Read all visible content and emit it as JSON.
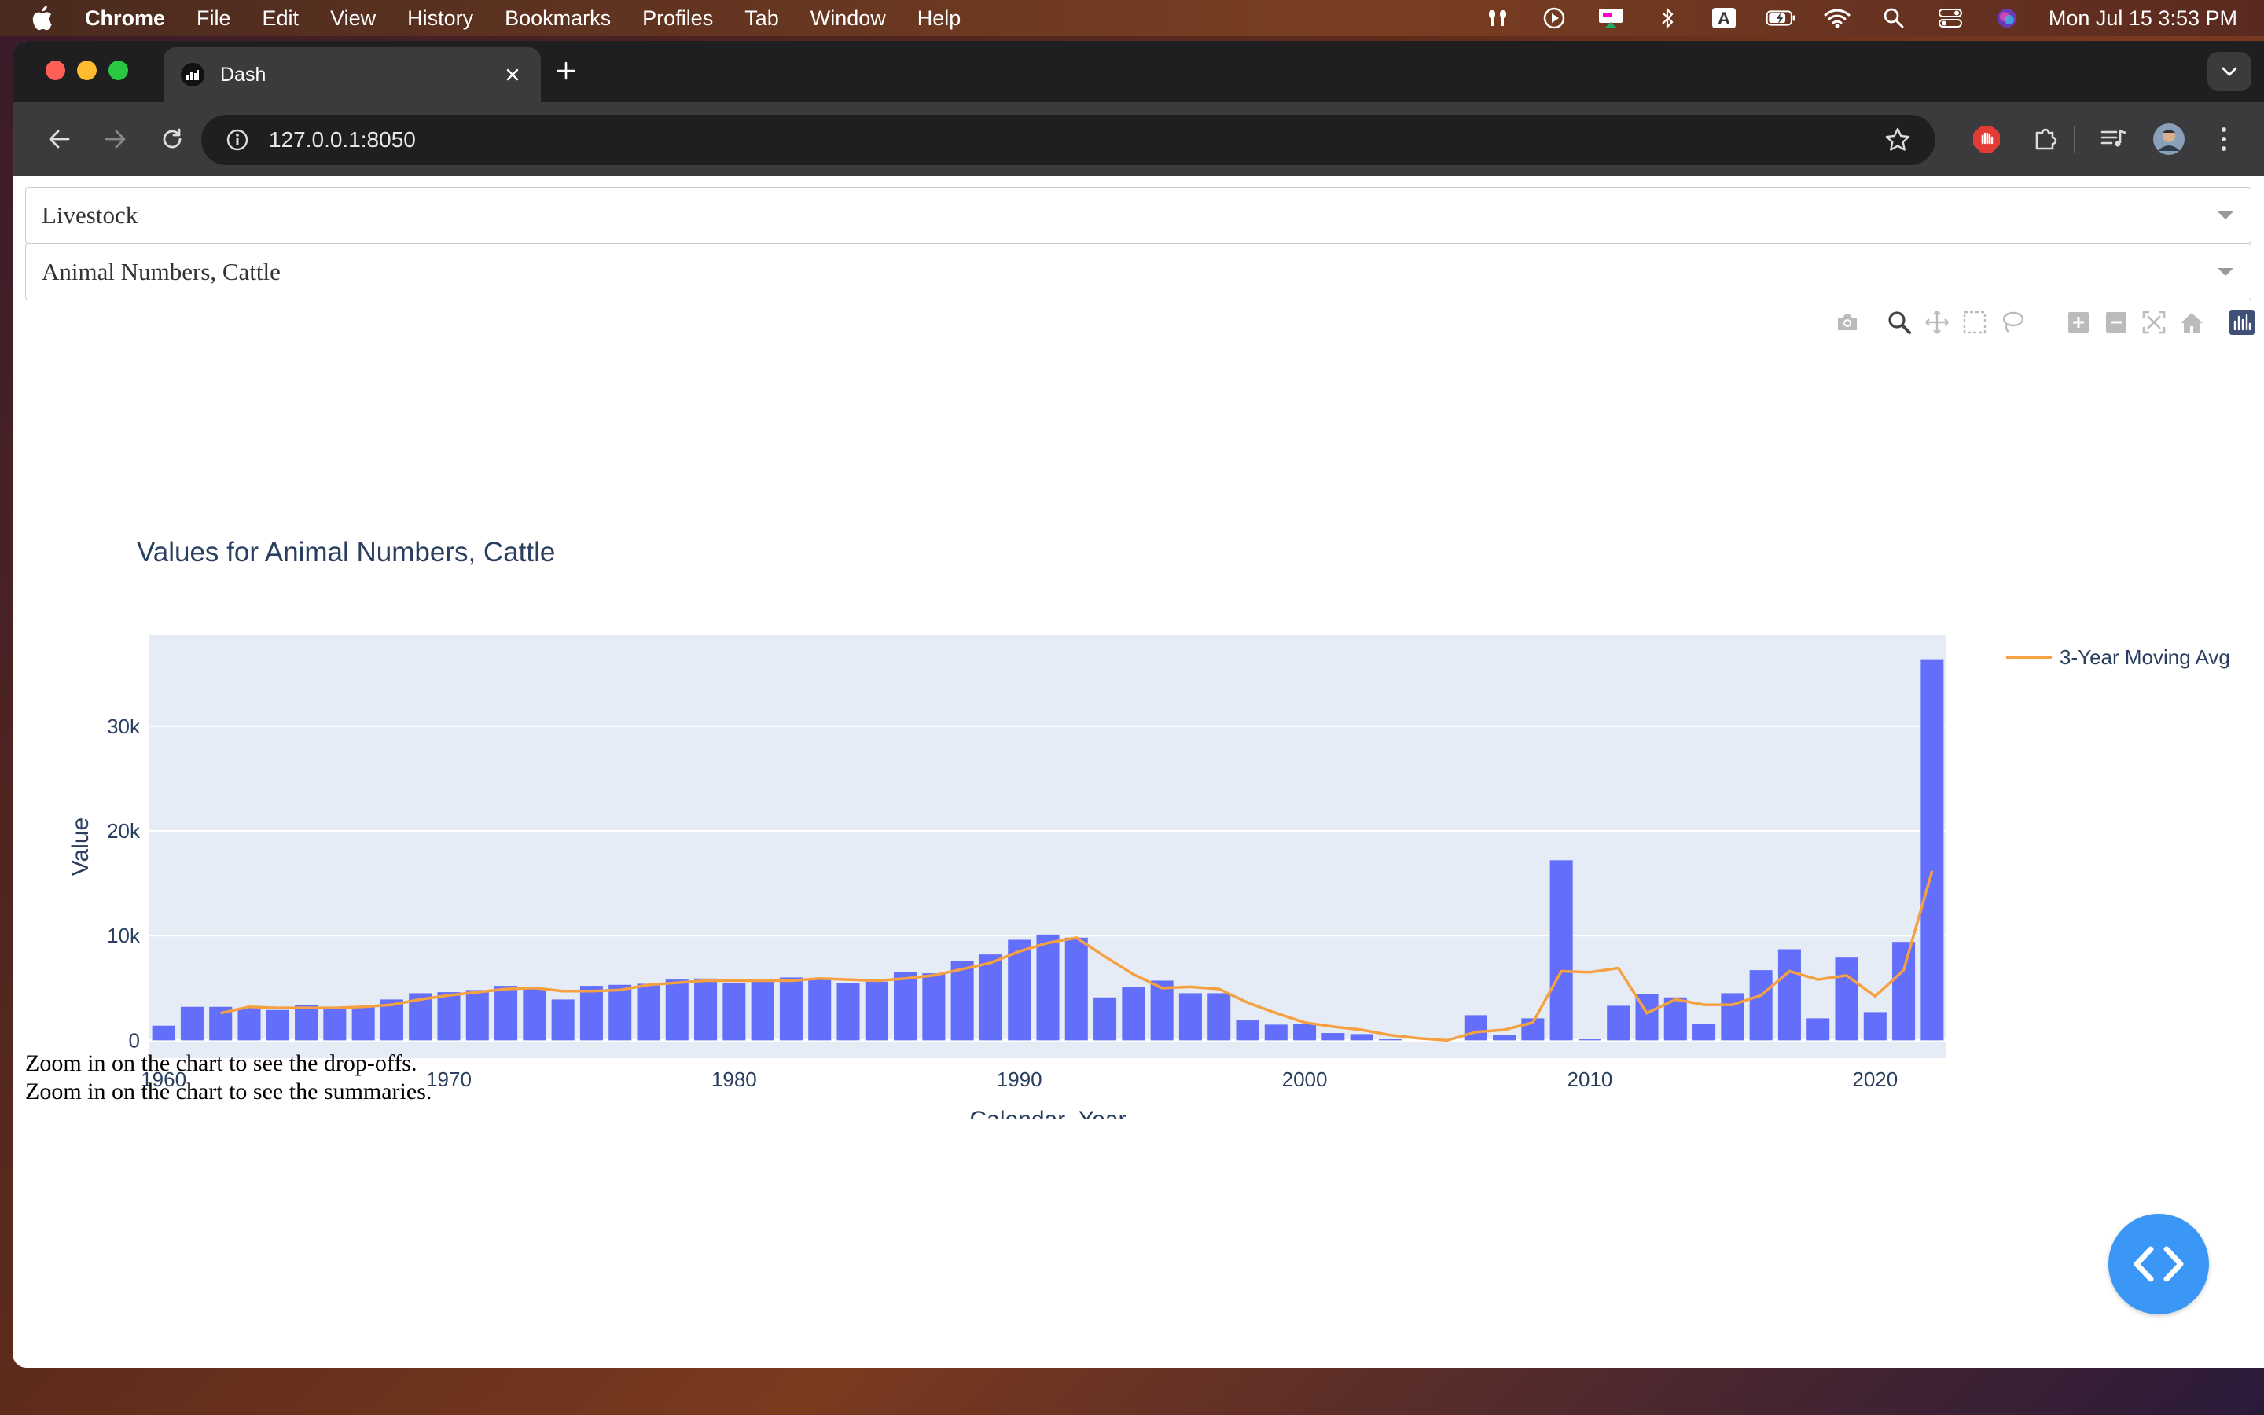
{
  "menubar": {
    "app": "Chrome",
    "items": [
      "File",
      "Edit",
      "View",
      "History",
      "Bookmarks",
      "Profiles",
      "Tab",
      "Window",
      "Help"
    ],
    "clock": "Mon Jul 15  3:53 PM"
  },
  "browser": {
    "tab_title": "Dash",
    "url": "127.0.0.1:8050"
  },
  "dropdowns": {
    "category": "Livestock",
    "item": "Animal Numbers, Cattle"
  },
  "summaries": {
    "dropoffs": "Zoom in on the chart to see the drop-offs.",
    "summaries": "Zoom in on the chart to see the summaries."
  },
  "chart_data": {
    "type": "bar",
    "title": "Values for Animal Numbers, Cattle",
    "xlabel": "Calendar_Year",
    "ylabel": "Value",
    "x": [
      1960,
      1961,
      1962,
      1963,
      1964,
      1965,
      1966,
      1967,
      1968,
      1969,
      1970,
      1971,
      1972,
      1973,
      1974,
      1975,
      1976,
      1977,
      1978,
      1979,
      1980,
      1981,
      1982,
      1983,
      1984,
      1985,
      1986,
      1987,
      1988,
      1989,
      1990,
      1991,
      1992,
      1993,
      1994,
      1995,
      1996,
      1997,
      1998,
      1999,
      2000,
      2001,
      2002,
      2003,
      2004,
      2005,
      2006,
      2007,
      2008,
      2009,
      2010,
      2011,
      2012,
      2013,
      2014,
      2015,
      2016,
      2017,
      2018,
      2019,
      2020,
      2021,
      2022
    ],
    "values": [
      1400,
      3200,
      3200,
      3100,
      2900,
      3400,
      3000,
      3200,
      3900,
      4500,
      4600,
      4800,
      5200,
      4900,
      3900,
      5200,
      5300,
      5400,
      5800,
      5900,
      5500,
      5700,
      6000,
      5900,
      5500,
      5600,
      6500,
      6400,
      7600,
      8200,
      9600,
      10100,
      9800,
      4100,
      5100,
      5700,
      4500,
      4500,
      1900,
      1500,
      1600,
      700,
      600,
      100,
      0,
      0,
      2400,
      500,
      2100,
      17200,
      100,
      3300,
      4400,
      4100,
      1600,
      4500,
      6700,
      8700,
      2100,
      7900,
      2700,
      9400,
      36400
    ],
    "series": [
      {
        "name": "3-Year Moving Avg",
        "type": "line",
        "color": "#f5a142",
        "x": [
          1962,
          1963,
          1964,
          1965,
          1966,
          1967,
          1968,
          1969,
          1970,
          1971,
          1972,
          1973,
          1974,
          1975,
          1976,
          1977,
          1978,
          1979,
          1980,
          1981,
          1982,
          1983,
          1984,
          1985,
          1986,
          1987,
          1988,
          1989,
          1990,
          1991,
          1992,
          1993,
          1994,
          1995,
          1996,
          1997,
          1998,
          1999,
          2000,
          2001,
          2002,
          2003,
          2004,
          2005,
          2006,
          2007,
          2008,
          2009,
          2010,
          2011,
          2012,
          2013,
          2014,
          2015,
          2016,
          2017,
          2018,
          2019,
          2020,
          2021,
          2022
        ],
        "values": [
          2600,
          3200,
          3100,
          3100,
          3100,
          3200,
          3400,
          3900,
          4300,
          4600,
          4900,
          5000,
          4700,
          4700,
          4800,
          5300,
          5500,
          5700,
          5700,
          5700,
          5700,
          5900,
          5800,
          5700,
          5900,
          6200,
          6800,
          7400,
          8500,
          9300,
          9800,
          8000,
          6300,
          5000,
          5100,
          4900,
          3600,
          2600,
          1700,
          1300,
          1000,
          500,
          200,
          0,
          800,
          1000,
          1700,
          6600,
          6500,
          6900,
          2600,
          3900,
          3400,
          3400,
          4300,
          6600,
          5800,
          6200,
          4200,
          6700,
          16200
        ]
      }
    ],
    "bar_color": "#636efa",
    "xlim": [
      1959.5,
      2022.5
    ],
    "ylim": [
      -1700,
      38700
    ],
    "y_ticks": [
      "0",
      "10k",
      "20k",
      "30k"
    ],
    "y_tick_values": [
      0,
      10000,
      20000,
      30000
    ],
    "x_ticks": [
      "1960",
      "1970",
      "1980",
      "1990",
      "2000",
      "2010",
      "2020"
    ],
    "x_tick_values": [
      1960,
      1970,
      1980,
      1990,
      2000,
      2010,
      2020
    ],
    "legend": "top-right",
    "grid": true
  }
}
